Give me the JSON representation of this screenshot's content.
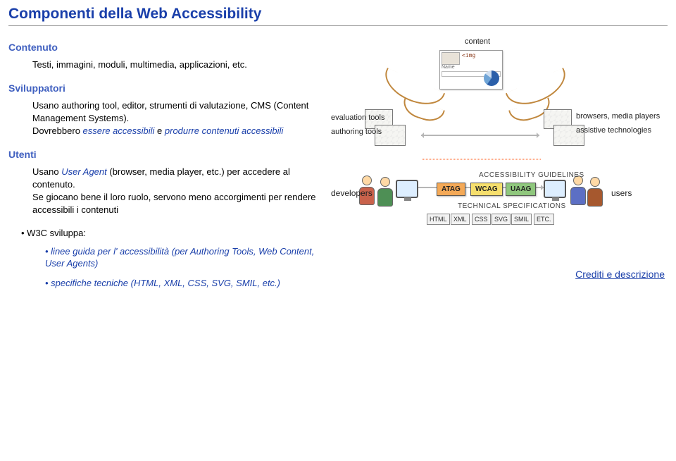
{
  "title": "Componenti della Web Accessibility",
  "sections": {
    "contenuto": {
      "heading": "Contenuto",
      "body": "Testi, immagini, moduli, multimedia, applicazioni, etc."
    },
    "sviluppatori": {
      "heading": "Sviluppatori",
      "body_pre": "Usano authoring tool, editor, strumenti di valutazione, CMS (Content Management Systems).",
      "body_mid1": "Dovrebbero ",
      "kw1": "essere accessibili",
      "body_mid2": " e ",
      "kw2": "produrre contenuti accessibili"
    },
    "utenti": {
      "heading": "Utenti",
      "body_pre": "Usano ",
      "kw1": "User Agent",
      "body_mid": " (browser, media player, etc.) per accedere al contenuto.",
      "body2": "Se giocano bene il loro ruolo, servono meno accorgimenti per rendere accessibili i contenuti"
    }
  },
  "w3c": {
    "heading": "W3C sviluppa:",
    "items": [
      {
        "kw": "linee guida",
        "rest": " per l' accessibilità (per Authoring Tools, Web Content, User Agents)"
      },
      {
        "kw": "specifiche tecniche",
        "rest": " (HTML, XML, CSS, SVG, SMIL, etc.)"
      }
    ]
  },
  "credits_link": "Crediti e descrizione",
  "diagram": {
    "labels": {
      "content": "content",
      "evaluation_tools": "evaluation tools",
      "authoring_tools": "authoring tools",
      "browsers": "browsers, media players",
      "assistive": "assistive technologies",
      "developers": "developers",
      "users": "users",
      "guidelines_section": "ACCESSIBILITY GUIDELINES",
      "specs_section": "TECHNICAL SPECIFICATIONS",
      "snippet_img_tag": "<img",
      "snippet_name": "Name"
    },
    "guidelines": {
      "atag": "ATAG",
      "wcag": "WCAG",
      "uaag": "UAAG"
    },
    "specs": [
      "HTML",
      "XML",
      "CSS",
      "SVG",
      "SMIL",
      "ETC."
    ]
  }
}
